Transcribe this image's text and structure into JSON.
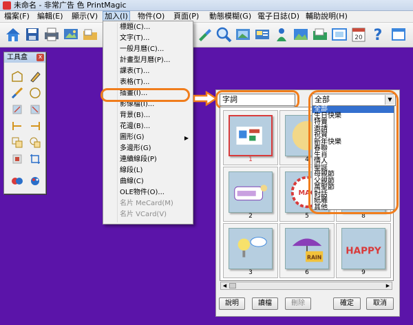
{
  "window": {
    "title": "未命名 - 非常广告 色 PrintMagic"
  },
  "menubar": {
    "items": [
      {
        "label": "檔案(F)"
      },
      {
        "label": "編輯(E)"
      },
      {
        "label": "顯示(V)"
      },
      {
        "label": "加入(I)"
      },
      {
        "label": "物件(O)"
      },
      {
        "label": "頁面(P)"
      },
      {
        "label": "動態模糊(G)"
      },
      {
        "label": "電子日誌(D)"
      },
      {
        "label": "輔助說明(H)"
      }
    ]
  },
  "toolbar": {
    "icons": [
      "home-icon",
      "save-icon",
      "print-icon",
      "image-icon",
      "open-icon",
      "zoom-icon",
      "photo-icon",
      "card-icon",
      "calendar-icon",
      "help-icon",
      "frame-icon"
    ],
    "calendar_day": "20"
  },
  "toolbox": {
    "title": "工具盒",
    "close": "x"
  },
  "insert_menu": {
    "items": [
      {
        "label": "標題(C)...",
        "disabled": false
      },
      {
        "label": "文字(T)...",
        "disabled": false
      },
      {
        "label": "一般月曆(C)...",
        "disabled": false
      },
      {
        "label": "計畫型月曆(P)...",
        "disabled": false
      },
      {
        "label": "課表(T)...",
        "disabled": false
      },
      {
        "label": "表格(T)...",
        "disabled": false
      },
      {
        "label": "插畫(I)...",
        "disabled": false
      },
      {
        "label": "影像檔(I)...",
        "disabled": false
      },
      {
        "label": "背景(B)...",
        "disabled": false
      },
      {
        "label": "花邊(B)...",
        "disabled": false
      },
      {
        "label": "圖形(G)",
        "disabled": false,
        "submenu": true
      },
      {
        "label": "多邊形(G)",
        "disabled": false
      },
      {
        "label": "連續線段(P)",
        "disabled": false
      },
      {
        "label": "線段(L)",
        "disabled": false
      },
      {
        "label": "曲線(C)",
        "disabled": false
      },
      {
        "label": "OLE物件(O)...",
        "disabled": false
      },
      {
        "label": "名片 MeCard(M)",
        "disabled": true
      },
      {
        "label": "名片 VCard(V)",
        "disabled": true
      }
    ],
    "submenu_arrow": "▶"
  },
  "clipart_panel": {
    "keyword": "字詞",
    "category_selected": "全部",
    "categories": [
      "全部",
      "生日快樂",
      "特賣",
      "邀請",
      "祝賀",
      "新年快樂",
      "春聯",
      "生肖",
      "情人",
      "聖誕",
      "母親節",
      "父親節",
      "萬聖節",
      "對話",
      "紙雕",
      "其他"
    ],
    "items": [
      "1",
      "2",
      "3",
      "4",
      "5",
      "6",
      "7",
      "8",
      "9"
    ],
    "selected_item": "1",
    "thumbnail_texts": {
      "5": "MAG",
      "6": "RAIN",
      "9": "HAPPY"
    },
    "buttons": {
      "help": "說明",
      "load": "讀檔",
      "delete": "刪除",
      "ok": "確定",
      "cancel": "取消"
    }
  },
  "colors": {
    "canvas": "#5b14a9",
    "highlight": "#f07d1c",
    "selection": "#3470cf"
  }
}
